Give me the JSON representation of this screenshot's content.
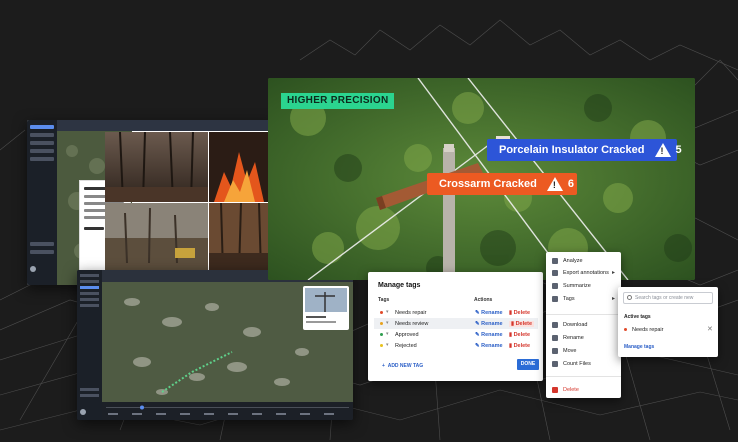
{
  "badge": {
    "label": "HIGHER PRECISION"
  },
  "detections": [
    {
      "label": "Porcelain Insulator Cracked",
      "count": "5",
      "color": "#2d55d8"
    },
    {
      "label": "Crossarm Cracked",
      "count": "6",
      "color": "#ec5a22"
    }
  ],
  "manage_tags": {
    "title": "Manage tags",
    "col_tags": "Tags",
    "col_actions": "Actions",
    "rename_label": "Rename",
    "delete_label": "Delete",
    "rows": [
      {
        "name": "Needs repair",
        "color": "#e14a2a"
      },
      {
        "name": "Needs review",
        "color": "#e8a21e"
      },
      {
        "name": "Approved",
        "color": "#2f9e4f"
      },
      {
        "name": "Rejected",
        "color": "#e8c21e"
      }
    ],
    "add_new_tag": "ADD NEW TAG",
    "done": "DONE"
  },
  "context_menu": {
    "items": [
      {
        "label": "Analyze",
        "icon": "analyze-icon"
      },
      {
        "label": "Export annotations",
        "icon": "export-icon",
        "submenu": true
      },
      {
        "label": "Summarize",
        "icon": "summarize-icon"
      },
      {
        "label": "Tags",
        "icon": "tag-icon",
        "submenu": true
      },
      {
        "label": "Download",
        "icon": "download-icon"
      },
      {
        "label": "Rename",
        "icon": "pencil-icon"
      },
      {
        "label": "Move",
        "icon": "move-icon"
      },
      {
        "label": "Count Files",
        "icon": "count-icon"
      },
      {
        "label": "Delete",
        "icon": "trash-icon",
        "danger": true
      }
    ]
  },
  "tag_flyout": {
    "search_placeholder": "Search tags or create new",
    "active_heading": "Active tags",
    "active_tag": "Needs repair",
    "manage_link": "Manage tags"
  }
}
